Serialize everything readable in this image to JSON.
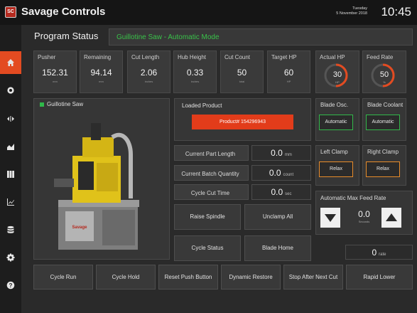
{
  "app": {
    "title": "Savage Controls",
    "logo_text": "SC"
  },
  "datetime": {
    "weekday": "Tuesday",
    "date": "5 November 2018",
    "time": "10:45"
  },
  "sidebar": {
    "items": [
      {
        "name": "home",
        "active": true
      },
      {
        "name": "gear"
      },
      {
        "name": "arrows"
      },
      {
        "name": "chart-area"
      },
      {
        "name": "columns"
      },
      {
        "name": "chart-line"
      },
      {
        "name": "database"
      },
      {
        "name": "settings"
      },
      {
        "name": "help"
      }
    ]
  },
  "program_status": {
    "label": "Program Status",
    "value": "Guillotine Saw - Automatic Mode",
    "value_color": "#39c24a"
  },
  "metrics": [
    {
      "label": "Pusher",
      "value": "152.31",
      "unit": "mm"
    },
    {
      "label": "Remaining",
      "value": "94.14",
      "unit": "mm"
    },
    {
      "label": "Cut Length",
      "value": "2.06",
      "unit": "inches"
    },
    {
      "label": "Hub Height",
      "value": "0.33",
      "unit": "inches"
    },
    {
      "label": "Cut Count",
      "value": "50",
      "unit": "total"
    },
    {
      "label": "Target HP",
      "value": "60",
      "unit": "HP"
    }
  ],
  "gauges": [
    {
      "label": "Actual HP",
      "value": "30",
      "unit": "HP",
      "fraction": 0.5
    },
    {
      "label": "Feed Rate",
      "value": "50",
      "unit": "%",
      "fraction": 0.5
    }
  ],
  "machine": {
    "title": "Guillotine Saw",
    "brand_text": "Savage"
  },
  "loaded_product": {
    "label": "Loaded Product",
    "button": "Product# 154296943"
  },
  "readouts": [
    {
      "label": "Current Part Length",
      "value": "0.0",
      "unit": "mm"
    },
    {
      "label": "Current Batch Quantity",
      "value": "0.0",
      "unit": "count"
    },
    {
      "label": "Cycle Cut Time",
      "value": "0.0",
      "unit": "sec"
    }
  ],
  "center_buttons": {
    "raise": "Raise Spindle",
    "unclamp": "Unclamp All",
    "cycle_status": "Cycle Status",
    "blade_home": "Blade Home"
  },
  "blade": {
    "osc_label": "Blade Osc.",
    "osc_value": "Automatic",
    "coolant_label": "Blade Coolant",
    "coolant_value": "Automatic",
    "left_clamp_label": "Left Clamp",
    "left_clamp_value": "Relax",
    "right_clamp_label": "Right Clamp",
    "right_clamp_value": "Relax"
  },
  "auto_max_feed": {
    "label": "Automatic Max Feed Rate",
    "value": "0.0",
    "unit": "Seconds"
  },
  "rate": {
    "value": "0",
    "unit": "rate"
  },
  "bottom_buttons": [
    "Cycle Run",
    "Cycle Hold",
    "Reset Push Button",
    "Dynamic Restore",
    "Stop After Next Cut",
    "Rapid Lower"
  ],
  "colors": {
    "accent": "#e34b21",
    "status_green": "#2fb84a",
    "product_button": "#e23c1a",
    "toggle_green": "#32b84a",
    "toggle_orange": "#e88c2a"
  }
}
